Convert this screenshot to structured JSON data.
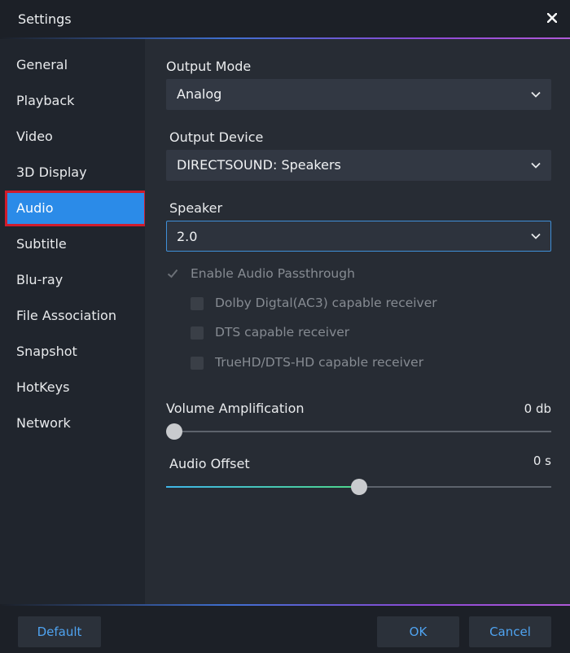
{
  "window": {
    "title": "Settings"
  },
  "sidebar": {
    "items": [
      {
        "label": "General"
      },
      {
        "label": "Playback"
      },
      {
        "label": "Video"
      },
      {
        "label": "3D Display"
      },
      {
        "label": "Audio",
        "active": true
      },
      {
        "label": "Subtitle"
      },
      {
        "label": "Blu-ray"
      },
      {
        "label": "File Association"
      },
      {
        "label": "Snapshot"
      },
      {
        "label": "HotKeys"
      },
      {
        "label": "Network"
      }
    ]
  },
  "audio": {
    "output_mode": {
      "label": "Output Mode",
      "value": "Analog"
    },
    "output_device": {
      "label": "Output Device",
      "value": "DIRECTSOUND: Speakers"
    },
    "speaker": {
      "label": "Speaker",
      "value": "2.0"
    },
    "passthrough": {
      "label": "Enable Audio Passthrough",
      "checked": true,
      "disabled": true,
      "options": [
        {
          "label": "Dolby Digtal(AC3) capable receiver",
          "checked": false
        },
        {
          "label": "DTS capable receiver",
          "checked": false
        },
        {
          "label": "TrueHD/DTS-HD capable receiver",
          "checked": false
        }
      ]
    },
    "volume_amplification": {
      "label": "Volume Amplification",
      "value": "0 db",
      "level": 0.0
    },
    "audio_offset": {
      "label": "Audio Offset",
      "value": "0 s",
      "level": 0.5
    }
  },
  "footer": {
    "default_label": "Default",
    "ok_label": "OK",
    "cancel_label": "Cancel"
  },
  "colors": {
    "accent": "#2b8be8",
    "highlight_outline": "#d01c2c",
    "button_text": "#4fa3f0"
  },
  "icons": {
    "close": "close-icon",
    "dropdown": "chevron-down-icon",
    "check": "check-icon"
  }
}
